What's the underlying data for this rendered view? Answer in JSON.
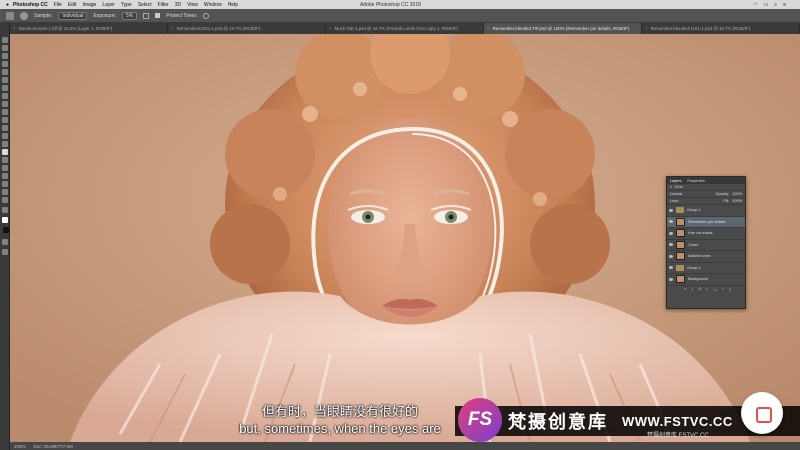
{
  "menubar": {
    "apple": "",
    "app_name": "Photoshop CC",
    "menus": [
      "File",
      "Edit",
      "Image",
      "Layer",
      "Type",
      "Select",
      "Filter",
      "3D",
      "View",
      "Window",
      "Help"
    ],
    "window_title": "Adobe Photoshop CC 2018"
  },
  "options_bar": {
    "sample_label": "Sample:",
    "sample_value": "Individual",
    "exposure_label": "Exposure:",
    "exposure_value": "5%",
    "protect_tones": "Protect Tones"
  },
  "tabs": [
    {
      "label": "Denim.remove-1.tiff @ 12.5% (Layer 1, RGB/8*)",
      "active": false
    },
    {
      "label": "Remember11001.1.psd @ 16.7% (RGB/8*)",
      "active": false
    },
    {
      "label": "Mock-Tab-1.psd @ 16.7% (Portrait Lumin from copy 1, RGB/8*)",
      "active": false
    },
    {
      "label": "Remember.blended.TIF.psd @ 100% (Remember per details, RGB/8*)",
      "active": true
    },
    {
      "label": "Remember.blended-1161-1.psd @ 16.7% (RGB/8*)",
      "active": false
    }
  ],
  "status_bar": {
    "zoom": "100%",
    "doc": "Doc: 65.9M/777.6M"
  },
  "layers_panel": {
    "tabs": [
      "Layers",
      "Properties"
    ],
    "kind": "Kind",
    "blend_mode": "Normal",
    "opacity_label": "Opacity:",
    "opacity_value": "100%",
    "lock_label": "Lock:",
    "fill_label": "Fill:",
    "fill_value": "100%",
    "layers": [
      {
        "name": "Group 1",
        "type": "group"
      },
      {
        "name": "Remember per details",
        "type": "pixel",
        "selected": true
      },
      {
        "name": "Hue cor tracks",
        "type": "pixel"
      },
      {
        "name": "Cures",
        "type": "pixel"
      },
      {
        "name": "Natural tones",
        "type": "pixel"
      },
      {
        "name": "Group 2",
        "type": "group"
      },
      {
        "name": "Background",
        "type": "pixel"
      }
    ]
  },
  "subtitles": {
    "cn": "但有时，当眼睛没有很好的",
    "en": "but, sometimes, when the eyes are"
  },
  "watermark": {
    "logo_text": "FS",
    "brand_cn": "梵摄创意库",
    "url": "WWW.FSTVC.CC",
    "small": "梵摄创意库 FSTVC.CC"
  },
  "colors": {
    "backdrop": "#c99d80",
    "hair": "#c9835a",
    "skin": "#e3ab8c",
    "fur": "#f1cdbd",
    "stroke": "#f4ece4"
  }
}
